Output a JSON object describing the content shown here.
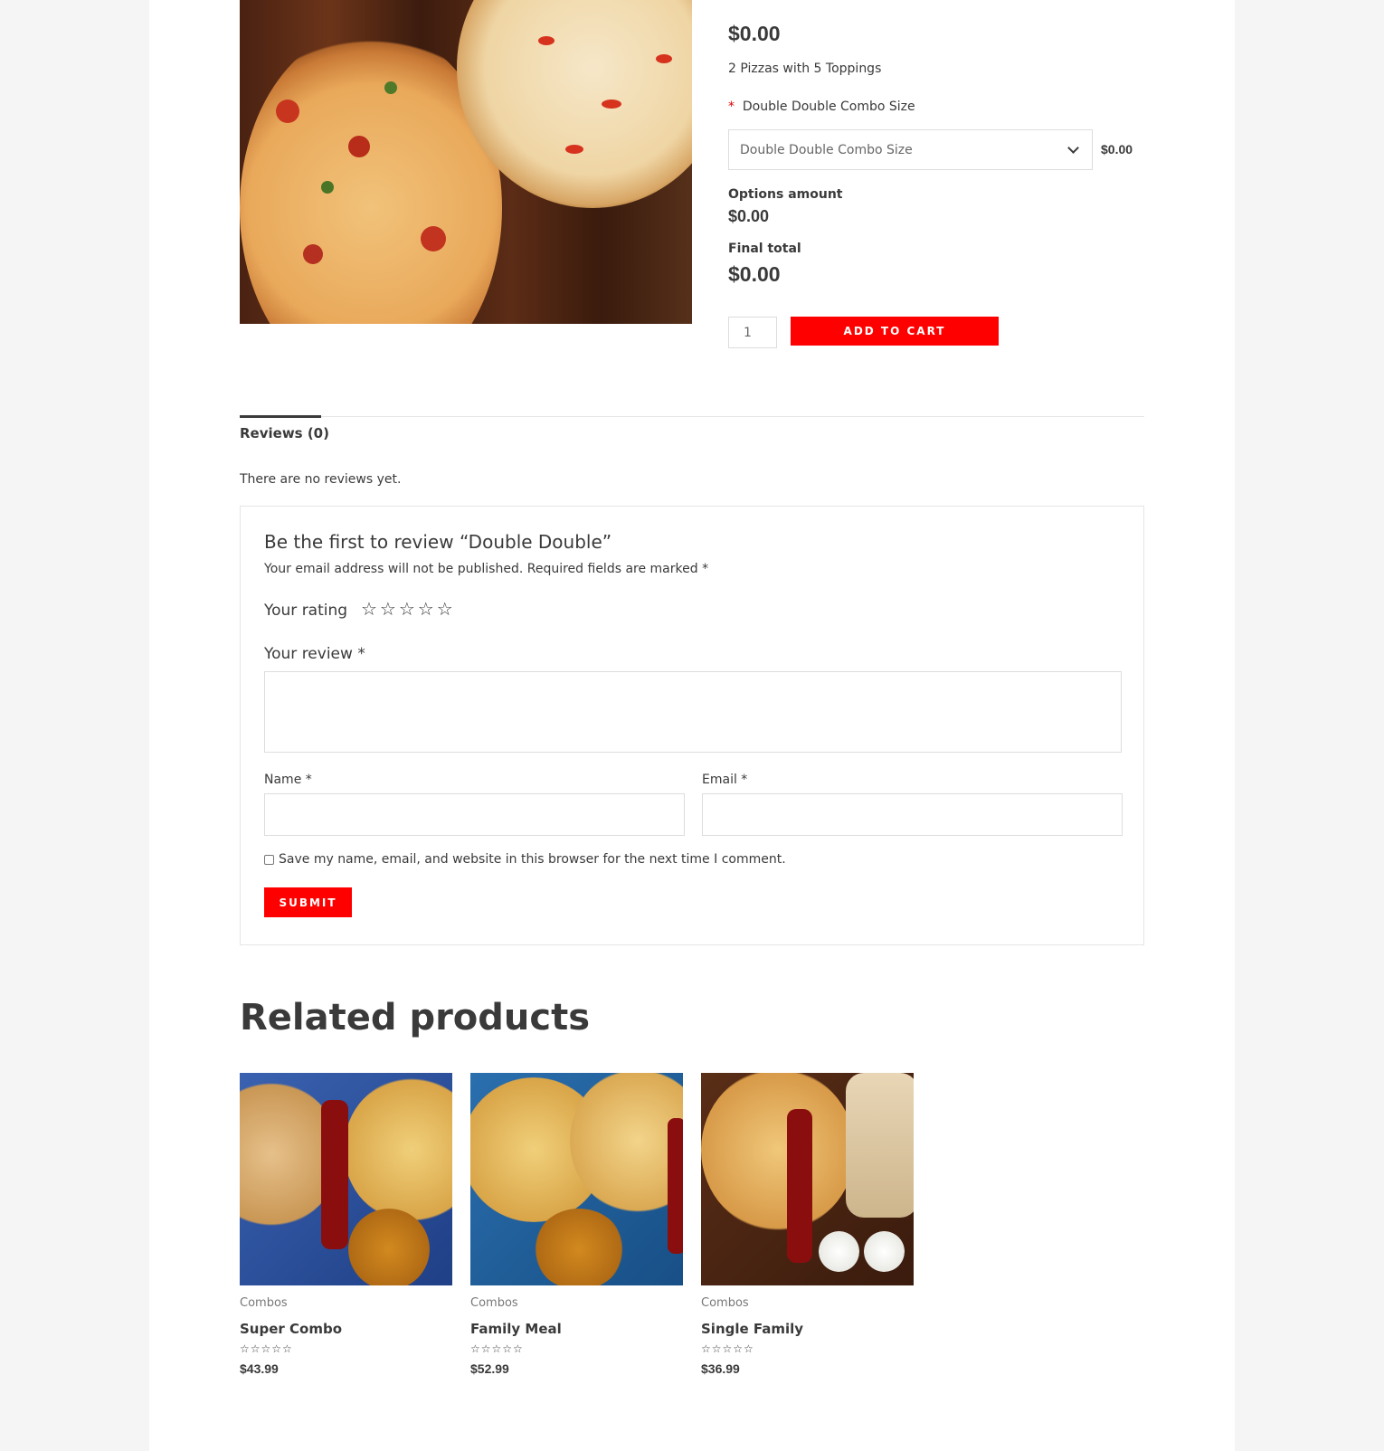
{
  "product": {
    "price": "$0.00",
    "short_description": "2 Pizzas with 5 Toppings",
    "option": {
      "required_marker": "*",
      "label": "Double Double Combo Size",
      "selected": "Double Double Combo Size",
      "price": "$0.00"
    },
    "options_amount_label": "Options amount",
    "options_amount": "$0.00",
    "final_total_label": "Final total",
    "final_total": "$0.00",
    "quantity": "1",
    "add_to_cart_label": "ADD TO CART"
  },
  "tabs": [
    {
      "label": "Reviews (0)"
    }
  ],
  "reviews": {
    "empty_text": "There are no reviews yet.",
    "form_title": "Be the first to review “Double Double”",
    "notes": "Your email address will not be published. Required fields are marked",
    "notes_required": "*",
    "rating_label": "Your rating",
    "stars": "☆☆☆☆☆",
    "review_label": "Your review",
    "review_required": "*",
    "name_label": "Name",
    "name_required": "*",
    "email_label": "Email",
    "email_required": "*",
    "cookies_consent": "Save my name, email, and website in this browser for the next time I comment.",
    "submit_label": "SUBMIT"
  },
  "related": {
    "heading": "Related products",
    "items": [
      {
        "category": "Combos",
        "title": "Super Combo",
        "rating_stars": "☆☆☆☆☆",
        "price": "$43.99"
      },
      {
        "category": "Combos",
        "title": "Family Meal",
        "rating_stars": "☆☆☆☆☆",
        "price": "$52.99"
      },
      {
        "category": "Combos",
        "title": "Single Family",
        "rating_stars": "☆☆☆☆☆",
        "price": "$36.99"
      }
    ]
  },
  "colors": {
    "accent": "#ff0000",
    "text": "#3a3a3a",
    "background": "#f5f5f5"
  }
}
